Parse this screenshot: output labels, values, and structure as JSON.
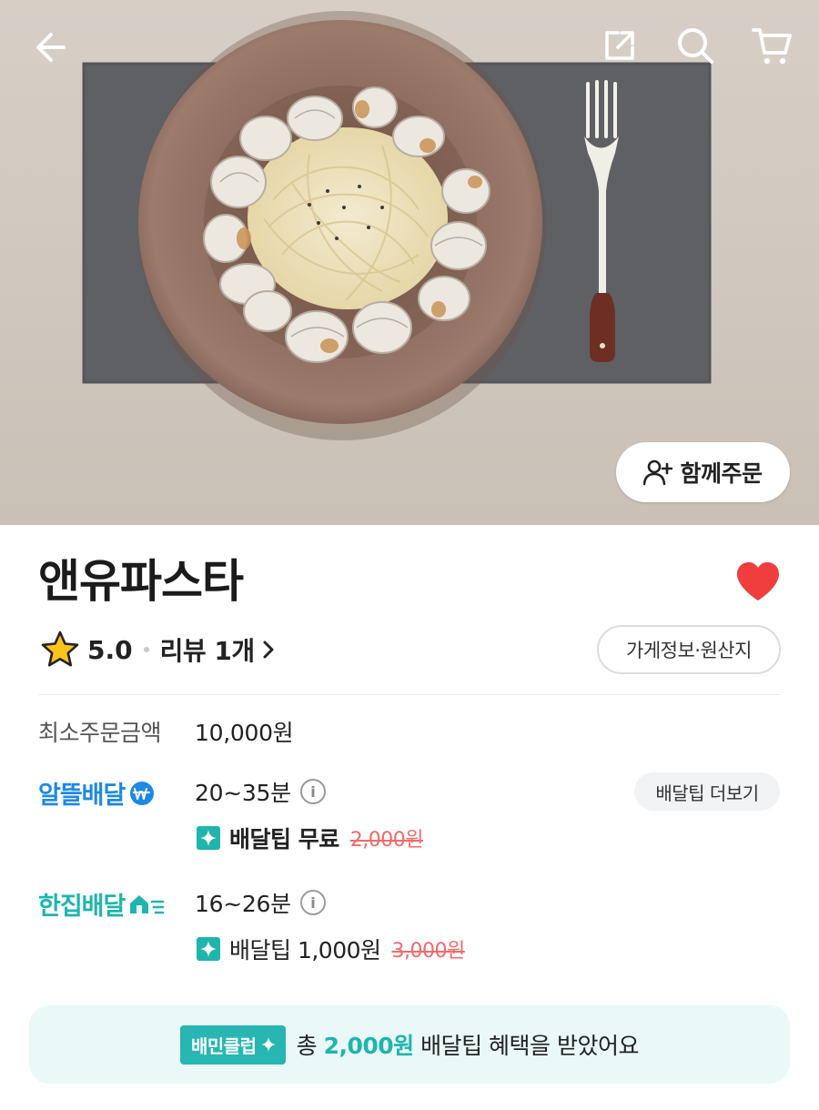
{
  "header": {
    "icons": [
      "back-arrow-icon",
      "share-icon",
      "search-icon",
      "cart-icon"
    ]
  },
  "hero": {
    "group_order_label": "함께주문"
  },
  "store": {
    "name": "앤유파스타",
    "rating": "5.0",
    "review_label": "리뷰 1개",
    "info_button": "가게정보·원산지",
    "favorited": true
  },
  "min_order": {
    "label": "최소주문금액",
    "value": "10,000원"
  },
  "delivery_saver": {
    "brand": "알뜰배달",
    "time": "20~35분",
    "tip_more": "배달팁 더보기",
    "tip_label": "배달팁 무료",
    "tip_original": "2,000원"
  },
  "delivery_single": {
    "brand": "한집배달",
    "time": "16~26분",
    "tip_label": "배달팁 1,000원",
    "tip_original": "3,000원"
  },
  "banner": {
    "badge": "배민클럽",
    "prefix": "총",
    "amount": "2,000원",
    "suffix": "배달팁 혜택을 받았어요"
  },
  "colors": {
    "accent_blue": "#1e88e5",
    "accent_teal": "#1fb5ad",
    "heart": "#f03d3d",
    "strike": "#f36a6a"
  }
}
